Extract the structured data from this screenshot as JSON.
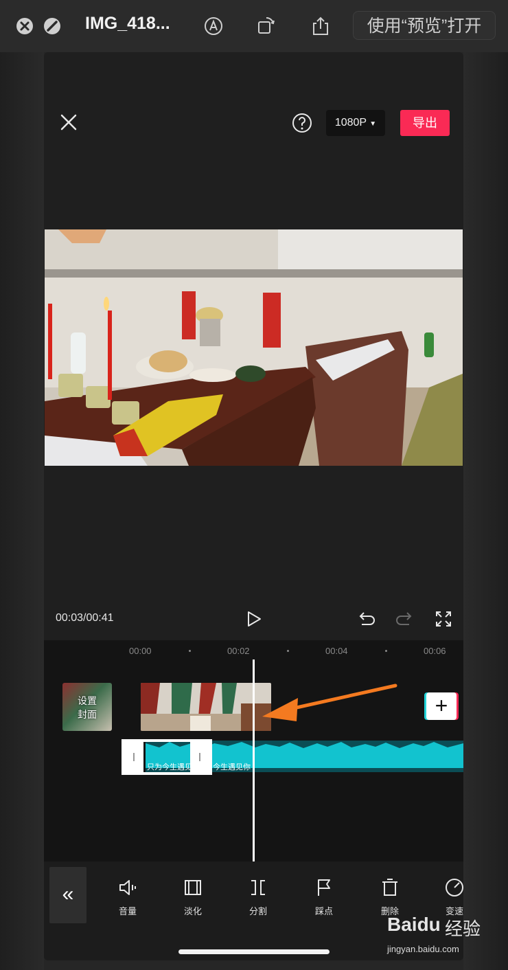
{
  "window": {
    "title": "IMG_418...",
    "open_with_button": "使用“预览”打开"
  },
  "editor": {
    "resolution": "1080P",
    "export_label": "导出",
    "timecode": "00:03/00:41"
  },
  "timeline": {
    "ticks": [
      "00:00",
      "00:02",
      "00:04",
      "00:06"
    ],
    "cover_label_line1": "设置",
    "cover_label_line2": "封面",
    "audio_caption_1": "只为今生遇见",
    "audio_caption_2": "今生遇见你",
    "add_button": "+"
  },
  "toolbar": {
    "collapse_glyph": "«",
    "items": [
      {
        "label": "音量",
        "icon": "volume-icon"
      },
      {
        "label": "淡化",
        "icon": "fade-icon"
      },
      {
        "label": "分割",
        "icon": "split-icon"
      },
      {
        "label": "踩点",
        "icon": "beat-flag-icon"
      },
      {
        "label": "删除",
        "icon": "delete-icon"
      },
      {
        "label": "变速",
        "icon": "speed-icon"
      }
    ]
  },
  "watermark": {
    "logo": "Baidu",
    "name": "经验",
    "url": "jingyan.baidu.com"
  },
  "colors": {
    "export": "#fa2a55",
    "audio": "#12c3cf",
    "annotation_arrow": "#f47a20"
  }
}
